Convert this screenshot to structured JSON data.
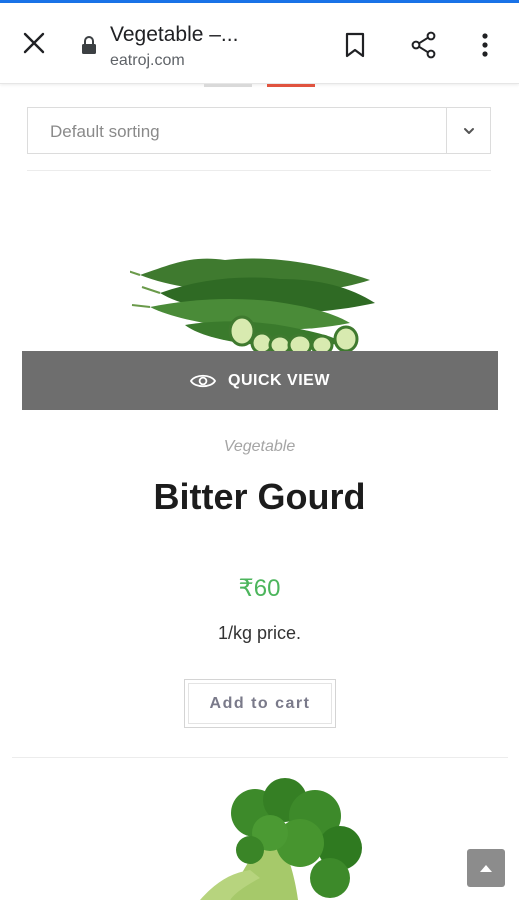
{
  "browser": {
    "title": "Vegetable –...",
    "url": "eatroj.com",
    "icons": [
      "close-icon",
      "lock-icon",
      "bookmark-icon",
      "share-icon",
      "more-vert-icon"
    ]
  },
  "sorting": {
    "selected": "Default sorting"
  },
  "product": {
    "quick_view_label": "QUICK VIEW",
    "category": "Vegetable",
    "name": "Bitter Gourd",
    "price": "₹60",
    "unit_label": "1/kg price.",
    "add_to_cart_label": "Add to cart"
  },
  "colors": {
    "accent_blue": "#1a73e8",
    "price_green": "#4cb55c",
    "tab_indicator_red": "#e0533f",
    "quick_view_bg": "#6e6e6e"
  }
}
